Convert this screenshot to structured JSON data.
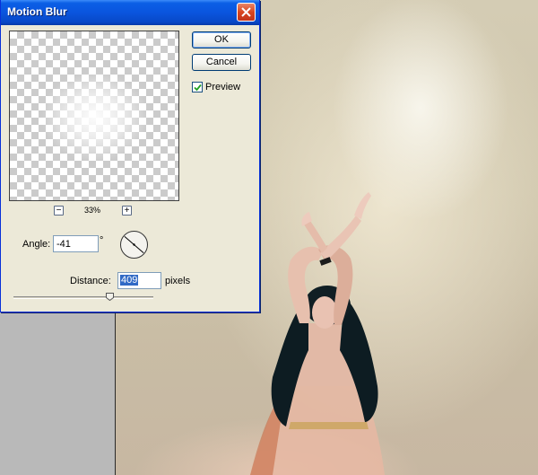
{
  "dialog": {
    "title": "Motion Blur",
    "ok_label": "OK",
    "cancel_label": "Cancel",
    "preview_label": "Preview",
    "preview_checked": true,
    "zoom_level": "33%",
    "zoom_minus": "−",
    "zoom_plus": "+",
    "angle_label": "Angle:",
    "angle_value": "-41",
    "angle_unit": "°",
    "distance_label": "Distance:",
    "distance_value": "409",
    "distance_unit": "pixels",
    "distance_slider_fraction": 0.69
  },
  "icons": {
    "close": "close-icon",
    "checkmark": "checkmark-icon",
    "angle_dial": "angle-dial-icon",
    "slider_thumb": "slider-thumb-icon"
  },
  "colors": {
    "titlebar": "#0a55de",
    "close_button": "#d9461f",
    "dialog_bg": "#ece9d8",
    "selection": "#316ac5"
  }
}
